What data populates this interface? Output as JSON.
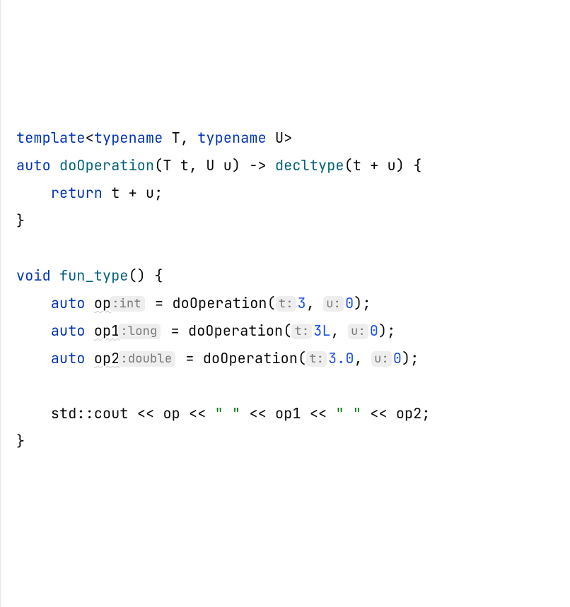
{
  "code": {
    "l1": {
      "template": "template",
      "lt": "<",
      "typename1": "typename",
      "T": " T",
      "comma": ", ",
      "typename2": "typename",
      "U": " U",
      "gt": ">"
    },
    "l2": {
      "auto": "auto ",
      "fn": "doOperation",
      "params": "(T t, U u) -> ",
      "decltype": "decltype",
      "expr": "(t + u) {"
    },
    "l3": {
      "indent": "    ",
      "return": "return",
      "expr": " t + u;"
    },
    "l4": {
      "brace": "}"
    },
    "l6": {
      "void": "void ",
      "fn": "fun_type",
      "rest": "() {"
    },
    "l7": {
      "indent": "    ",
      "auto": "auto ",
      "var": "op",
      "eq": " = ",
      "fn": "doOperation",
      "open": "(",
      "arg1": "3",
      "comma": ", ",
      "arg2": "0",
      "close": ");",
      "hint_type": ":int",
      "hint_p1": "t:",
      "hint_p2": "u:"
    },
    "l8": {
      "indent": "    ",
      "auto": "auto ",
      "var": "op1",
      "eq": " = ",
      "fn": "doOperation",
      "open": "(",
      "arg1": "3L",
      "comma": ", ",
      "arg2": "0",
      "close": ");",
      "hint_type": ":long",
      "hint_p1": "t:",
      "hint_p2": "u:"
    },
    "l9": {
      "indent": "    ",
      "auto": "auto ",
      "var": "op2",
      "eq": " = ",
      "fn": "doOperation",
      "open": "(",
      "arg1": "3.0",
      "comma": ", ",
      "arg2": "0",
      "close": ");",
      "hint_type": ":double",
      "hint_p1": "t:",
      "hint_p2": "u:"
    },
    "l11": {
      "indent": "    ",
      "std": "std",
      "scope": "::",
      "cout": "cout",
      "s1": " << op << ",
      "str1": "\" \"",
      "s2": " << op1 << ",
      "str2": "\" \"",
      "s3": " << op2;"
    },
    "l12": {
      "brace": "}"
    }
  }
}
